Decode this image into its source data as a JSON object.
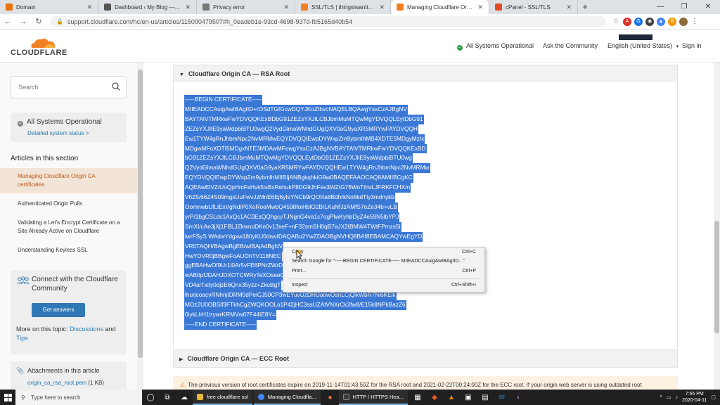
{
  "browser": {
    "tabs": [
      {
        "title": "Domain",
        "color": "#e8710a",
        "active": false
      },
      {
        "title": "Dashboard ‹ My Blog — WordPress",
        "color": "#555555",
        "active": false
      },
      {
        "title": "Privacy error",
        "color": "#777777",
        "active": false
      },
      {
        "title": "SSL/TLS | thingsiwanttosay.com | A",
        "color": "#f38020",
        "active": false
      },
      {
        "title": "Managing Cloudflare Origin CA cert",
        "color": "#f38020",
        "active": true
      },
      {
        "title": "cPanel - SSL/TLS",
        "color": "#e34a2a",
        "active": false
      }
    ],
    "new_tab": "+",
    "window_controls": [
      "—",
      "❐",
      "✕"
    ],
    "url": "support.cloudflare.com/hc/en-us/articles/115000479507#h_0eadeb1e-93cd-4698-937d-fb5165d40b54",
    "nav": {
      "back": "←",
      "forward": "→",
      "reload": "↻"
    }
  },
  "header": {
    "logo_text": "CLOUDFLARE",
    "status": "All Systems Operational",
    "community": "Ask the Community",
    "language": "English (United States)",
    "signin": "Sign in"
  },
  "sidebar": {
    "search_placeholder": "Search",
    "status_title": "All Systems Operational",
    "status_link": "Detailed system status >",
    "section_title": "Articles in this section",
    "articles": [
      {
        "label": "Managing Cloudflare Origin CA certificates",
        "active": true
      },
      {
        "label": "Authenticated Origin Pulls",
        "active": false
      },
      {
        "label": "Validating a Let's Encrypt Certificate on a Site Already Active on Cloudflare",
        "active": false
      },
      {
        "label": "Understanding Keyless SSL",
        "active": false
      }
    ],
    "community": {
      "title": "Connect with the Cloudflare Community",
      "button": "Get answers",
      "more_prefix": "More on this topic:",
      "link1": "Discussions",
      "and": "and",
      "link2": "Tips"
    },
    "attachments": {
      "title": "Attachments in this article",
      "file": "origin_ca_rsa_root.pem",
      "size": "(1 KB)"
    }
  },
  "main": {
    "rsa_title": "Cloudflare Origin CA — RSA Root",
    "ecc_title": "Cloudflare Origin CA — ECC Root",
    "certificate_lines": [
      "-----BEGIN CERTIFICATE-----",
      "MIIEADCCAuigAwIBAgIID+rOSdTGfGcwDQYJKoZIhvcNAQELBQAwgYsxCzAJBgNV",
      "BAYTAlVTMRkwFwYDVQQKExBDbG91ZEZsYXJlLCBJbmMuMTQwMgYDVQQLEytDbG91",
      "ZEZsYXJlIE9yaWdpbiBTU0wgQ2VydGlmaWNhdGUgQXV0aG9yaXR5MRYwFAYDVQQH",
      "Ew1TYW4gRnJhbmNpc2NvMRMwEQYDVQQIEwpDYWxpZm9ybmlhMB4XDTE5MDgyMzIx",
      "MDgwMFoXDTI5MDgxNTE3MDAwMFowgYsxCzAJBgNVBAYTAlVTMRkwFwYDVQQKExBD",
      "bG91ZEZsYXJlLCBJbmMuMTQwMgYDVQQLEytDbG91ZEZsYXJlIE9yaWdpbiBTU0wg",
      "Q2VydGlmaWNhdGUgQXV0aG9yaXR5MRYwFAYDVQQHEw1TYW4gRnJhbmNpc2NvMRMw",
      "EQYDVQQIEwpDYWxpZm9ybmlhMIIBIjANBgkqhkiG9w0BAQEFAAOCAQ8AMIIBCgKC",
      "AQEAwEiVZ/UoQpHmFsHvk5isBxRehukP8DG9JhFev3WZtG76WoTthvLJFRKFCHXm",
      "V6Z5/66Z4S09mgsUuFwvJzMnE6Ej6yIsYNCb9rQORa8BdhrkNn6kdTly3mdnykb",
      "OomnwbUfLlExVgNdlP0XoRoeMwbQ4598foiHblO2B/LKuNfJzAMfS7oZe34b+vLB",
      "yrP/1bgCSLdc1AxQc1AC0EsQQhgcyTJNgnG4va1c7ogPlwKyhbDyZ4e59N5lbYPJ",
      "SmXI/cAe3jXj1FBLJZkwnoDKe0v13xeF+nF32smSH0qB7aJX2tBMW4TWtFPmzs5I",
      "lwrFSyS WAdwYdgxw180yKU0dwvIDAQABo2YwZDAOBgNVHQ8BAf8EBAMCAQYwEgYD",
      "VR0TAQH/BAgwBgEB/wIBAjAdBgNV",
      "HwYDVR0jBBgwFoAUOhTV118NEC",
      "ggEBAHwOf9Ur1l0Ar5vFE6PNrZWrD",
      "wAB0pfJDAHJDXOTCWRyTeXOseeO",
      "VD4alTxity0djzE6Qnx35yzz+ZkoBgT",
      "lhurjcoacvRNhnjIDRM0dPeiCJ50CP3wEYuvUzDHUaowOsnLCjQlkWbR7Ni6KElk",
      "MOz2U0OBSif3FTkhCgZWQKOOLo1P42jHC3ssUZAtVNXrCk3fw9/E15k8NPkBazZ6",
      "0iykLhH1trywrKRMVw67F44IE8Y=",
      "-----END CERTIFICATE-----"
    ],
    "warning": "The previous version of root certificates expire on 2019-11-14T01:43:50Z for the RSA root and 2021-02-22T00:24:00Z for the ECC root. If your origin web server is using outdated root"
  },
  "context_menu": {
    "items": [
      {
        "label": "Copy",
        "shortcut": "Ctrl+C"
      },
      {
        "label": "Search Google for \"-----BEGIN CERTIFICATE----- MIIEADCCAuigAwIBAgIID...\"",
        "shortcut": ""
      },
      {
        "label": "Print...",
        "shortcut": "Ctrl+P"
      },
      {
        "label": "Inspect",
        "shortcut": "Ctrl+Shift+I"
      }
    ]
  },
  "taskbar": {
    "search_placeholder": "Type here to search",
    "apps": [
      {
        "label": "free cloudflare ssl",
        "color": "#e8b83a"
      },
      {
        "label": "Managing Cloudfla...",
        "color": "#4285f4"
      },
      {
        "label": "HTTP / HTTPS Hea...",
        "color": "#3b3b3b"
      }
    ],
    "time": "7:55 PM",
    "date": "2020-04-11"
  },
  "colors": {
    "selection": "#3a78d6",
    "brand_orange": "#f38020",
    "link": "#2a7ab0",
    "button": "#2f78b5",
    "status_green": "#2f9e44"
  }
}
